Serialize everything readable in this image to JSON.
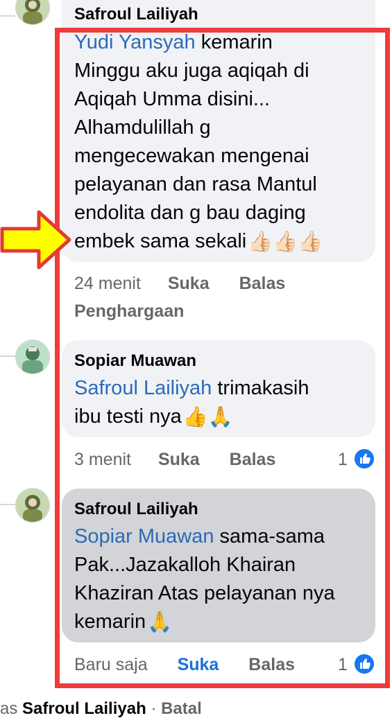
{
  "comments": [
    {
      "author": "Safroul Lailiyah",
      "mention": "Yudi Yansyah",
      "text": " kemarin\nMinggu aku juga aqiqah di\nAqiqah Umma disini...\nAlhamdulillah g\nmengecewakan mengenai\npelayanan dan rasa Mantul\nendolita dan g bau daging\nembek sama sekali",
      "emoji": "👍🏻👍🏻👍🏻",
      "time": "24 menit",
      "like_label": "Suka",
      "reply_label": "Balas",
      "extra_label": "Penghargaan"
    },
    {
      "author": "Sopiar Muawan",
      "mention": "Safroul Lailiyah",
      "text": " trimakasih\nibu testi nya",
      "emoji": "👍🙏",
      "time": "3 menit",
      "like_label": "Suka",
      "reply_label": "Balas",
      "reaction_count": "1"
    },
    {
      "author": "Safroul Lailiyah",
      "mention": "Sopiar Muawan",
      "text": " sama-sama\nPak...Jazakalloh Khairan\nKhaziran Atas pelayanan nya\nkemarin",
      "emoji": "🙏",
      "time": "Baru saja",
      "like_label": "Suka",
      "reply_label": "Balas",
      "reaction_count": "1"
    }
  ],
  "footer": {
    "prefix": "as ",
    "name": "Safroul Lailiyah",
    "separator": " · ",
    "cancel": "Batal"
  },
  "colors": {
    "mention": "#2d6ab8",
    "like_active": "#1a6fdc",
    "highlight_box": "#ef3b3b",
    "arrow_fill": "#ffff00",
    "arrow_stroke": "#e53935"
  }
}
